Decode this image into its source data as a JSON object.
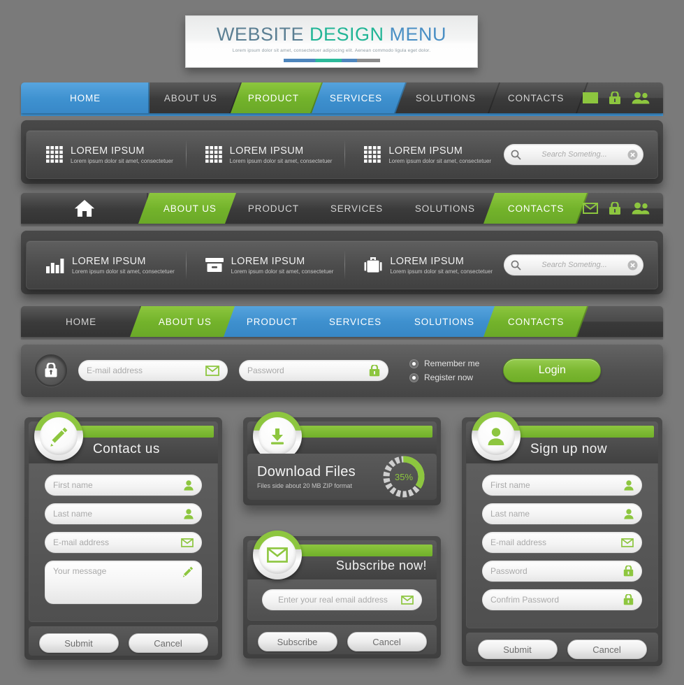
{
  "banner": {
    "word1": "WEBSITE",
    "word2": "DESIGN",
    "word3": "MENU",
    "subtitle": "Lorem ipsum dolor sit amet, consectetuer adipiscing elit. Aenean commodo ligula eget dolor."
  },
  "colors": {
    "green": "#8dc63f",
    "blue": "#3f92d0",
    "dark": "#4a4a4a",
    "page_bg": "#7a7a7a"
  },
  "nav1": {
    "items": [
      {
        "label": "HOME",
        "style": "active-blue"
      },
      {
        "label": "ABOUT US",
        "style": "dark"
      },
      {
        "label": "PRODUCT",
        "style": "green"
      },
      {
        "label": "SERVICES",
        "style": "blue"
      },
      {
        "label": "SOLUTIONS",
        "style": "dark"
      },
      {
        "label": "CONTACTS",
        "style": "dark"
      }
    ],
    "icons": [
      "envelope-icon",
      "lock-icon",
      "users-icon"
    ]
  },
  "nav2": {
    "home_icon": "home-icon",
    "items": [
      {
        "label": "ABOUT US",
        "style": "green"
      },
      {
        "label": "PRODUCT",
        "style": "dark"
      },
      {
        "label": "SERVICES",
        "style": "dark"
      },
      {
        "label": "SOLUTIONS",
        "style": "dark"
      },
      {
        "label": "CONTACTS",
        "style": "green"
      }
    ],
    "icons": [
      "envelope-icon",
      "lock-icon",
      "users-icon"
    ]
  },
  "nav3": {
    "items": [
      {
        "label": "HOME",
        "style": "dark"
      },
      {
        "label": "ABOUT US",
        "style": "green"
      },
      {
        "label": "PRODUCT",
        "style": "blue"
      },
      {
        "label": "SERVICES",
        "style": "blue"
      },
      {
        "label": "SOLUTIONS",
        "style": "blue"
      },
      {
        "label": "CONTACTS",
        "style": "green"
      }
    ]
  },
  "toolbar1": {
    "features": [
      {
        "icon": "grid-icon",
        "title": "LOREM IPSUM",
        "sub": "Lorem ipsum dolor sit amet, consectetuer"
      },
      {
        "icon": "grid-icon",
        "title": "LOREM IPSUM",
        "sub": "Lorem ipsum dolor sit amet, consectetuer"
      },
      {
        "icon": "grid-icon",
        "title": "LOREM IPSUM",
        "sub": "Lorem ipsum dolor sit amet, consectetuer"
      }
    ],
    "search_placeholder": "Search Someting..."
  },
  "toolbar2": {
    "features": [
      {
        "icon": "bar-chart-icon",
        "title": "LOREM IPSUM",
        "sub": "Lorem ipsum dolor sit amet, consectetuer"
      },
      {
        "icon": "archive-box-icon",
        "title": "LOREM IPSUM",
        "sub": "Lorem ipsum dolor sit amet, consectetuer"
      },
      {
        "icon": "briefcase-icon",
        "title": "LOREM IPSUM",
        "sub": "Lorem ipsum dolor sit amet, consectetuer"
      }
    ],
    "search_placeholder": "Search Someting..."
  },
  "login": {
    "lock_icon": "lock-icon",
    "email_placeholder": "E-mail address",
    "email_icon": "envelope-icon",
    "password_placeholder": "Password",
    "password_icon": "lock-icon",
    "remember_label": "Remember me",
    "register_label": "Register now",
    "login_button": "Login"
  },
  "contact_card": {
    "badge_icon": "pencil-icon",
    "title": "Contact us",
    "fields": [
      {
        "placeholder": "First name",
        "icon": "user-icon"
      },
      {
        "placeholder": "Last name",
        "icon": "user-icon"
      },
      {
        "placeholder": "E-mail address",
        "icon": "envelope-icon"
      },
      {
        "placeholder": "Your message",
        "icon": "pencil-icon"
      }
    ],
    "submit_label": "Submit",
    "cancel_label": "Cancel"
  },
  "download_card": {
    "badge_icon": "download-icon",
    "title": "Download Files",
    "subtitle": "Files side about 20 MB ZIP format",
    "progress_percent": "35%",
    "progress_value": 35
  },
  "subscribe_card": {
    "badge_icon": "envelope-icon",
    "title": "Subscribe now!",
    "email_placeholder": "Enter your real email address",
    "email_icon": "envelope-icon",
    "subscribe_label": "Subscribe",
    "cancel_label": "Cancel"
  },
  "signup_card": {
    "badge_icon": "user-icon",
    "title": "Sign up now",
    "fields": [
      {
        "placeholder": "First name",
        "icon": "user-icon"
      },
      {
        "placeholder": "Last name",
        "icon": "user-icon"
      },
      {
        "placeholder": "E-mail address",
        "icon": "envelope-icon"
      },
      {
        "placeholder": "Password",
        "icon": "lock-icon"
      },
      {
        "placeholder": "Confrim Password",
        "icon": "lock-icon"
      }
    ],
    "submit_label": "Submit",
    "cancel_label": "Cancel"
  }
}
